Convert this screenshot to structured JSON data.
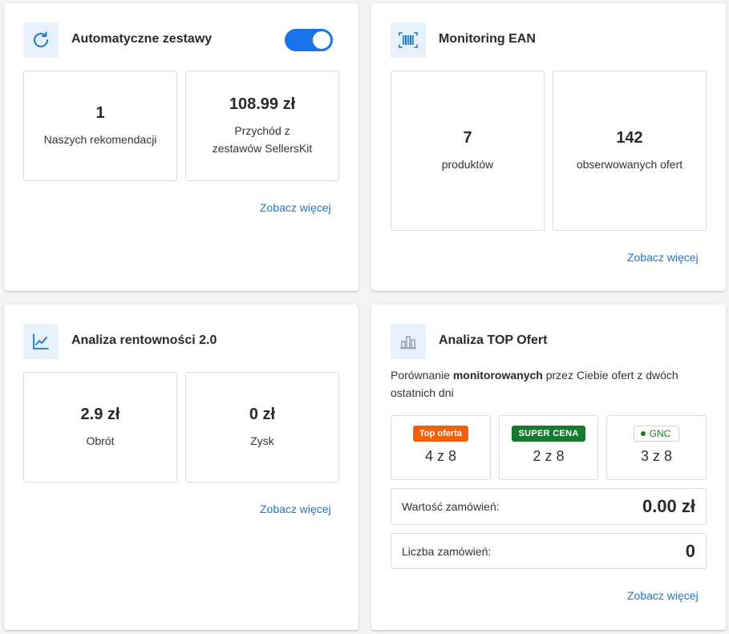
{
  "colors": {
    "accent": "#1f76c8",
    "toggle_on": "#1a73e8",
    "icon_bg": "#e6f1fb",
    "top_offer": "#f2610a",
    "super_price": "#157a2c"
  },
  "sets": {
    "icon": "refresh-icon",
    "title": "Automatyczne zestawy",
    "toggle_on": true,
    "stats": [
      {
        "value": "1",
        "label": "Naszych rekomendacji"
      },
      {
        "value": "108.99 zł",
        "label": "Przychód z zestawów SellersKit"
      }
    ],
    "more": "Zobacz więcej"
  },
  "ean": {
    "icon": "barcode-icon",
    "title": "Monitoring EAN",
    "stats": [
      {
        "value": "7",
        "label": "produktów"
      },
      {
        "value": "142",
        "label": "obserwowanych ofert"
      }
    ],
    "more": "Zobacz więcej"
  },
  "profit": {
    "icon": "line-chart-icon",
    "title": "Analiza rentowności 2.0",
    "stats": [
      {
        "value": "2.9 zł",
        "label": "Obrót"
      },
      {
        "value": "0 zł",
        "label": "Zysk"
      }
    ],
    "more": "Zobacz więcej"
  },
  "top": {
    "icon": "bar-chart-icon",
    "title": "Analiza TOP Ofert",
    "desc_before": "Porównanie ",
    "desc_bold": "monitorowanych",
    "desc_after": " przez Ciebie ofert z dwóch ostatnich dni",
    "badges": [
      {
        "label": "Top oferta",
        "count": "4 z 8"
      },
      {
        "label": "SUPER CENA",
        "count": "2 z 8"
      },
      {
        "label": "GNC",
        "count": "3 z 8"
      }
    ],
    "order_value_label": "Wartość zamówień:",
    "order_value": "0.00 zł",
    "order_count_label": "Liczba zamówień:",
    "order_count": "0",
    "more": "Zobacz więcej"
  }
}
